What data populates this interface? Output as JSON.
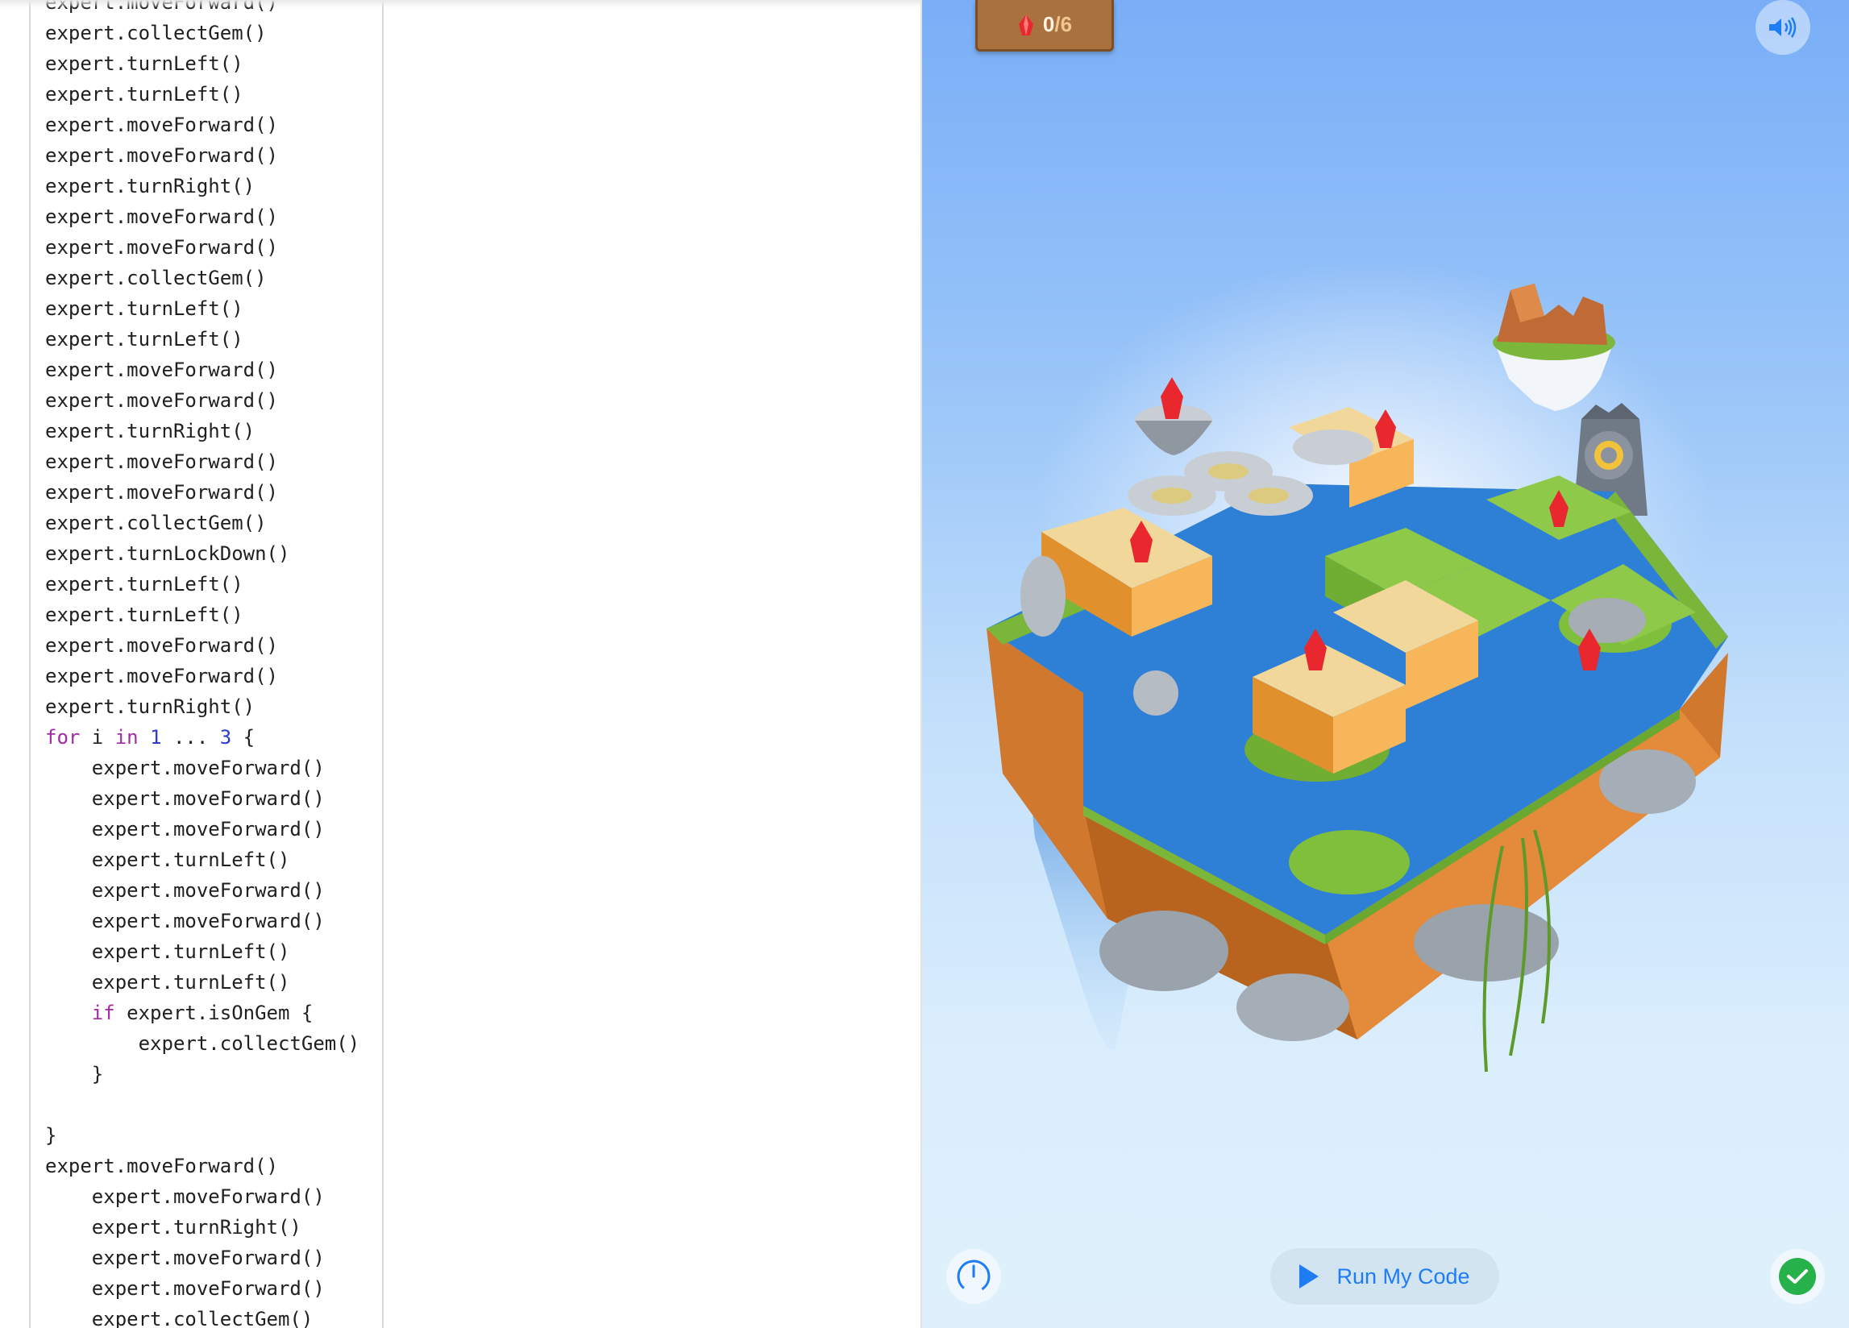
{
  "editor": {
    "code_lines": [
      "expert.moveForward()",
      "expert.collectGem()",
      "expert.turnLeft()",
      "expert.turnLeft()",
      "expert.moveForward()",
      "expert.moveForward()",
      "expert.turnRight()",
      "expert.moveForward()",
      "expert.moveForward()",
      "expert.collectGem()",
      "expert.turnLeft()",
      "expert.turnLeft()",
      "expert.moveForward()",
      "expert.moveForward()",
      "expert.turnRight()",
      "expert.moveForward()",
      "expert.moveForward()",
      "expert.collectGem()",
      "expert.turnLockDown()",
      "expert.turnLeft()",
      "expert.turnLeft()",
      "expert.moveForward()",
      "expert.moveForward()",
      "expert.turnRight()",
      "for i in 1 ... 3 {",
      "    expert.moveForward()",
      "    expert.moveForward()",
      "    expert.moveForward()",
      "    expert.turnLeft()",
      "    expert.moveForward()",
      "    expert.moveForward()",
      "    expert.turnLeft()",
      "    expert.turnLeft()",
      "    if expert.isOnGem {",
      "        expert.collectGem()",
      "    }",
      "",
      "}",
      "expert.moveForward()",
      "    expert.moveForward()",
      "    expert.turnRight()",
      "    expert.moveForward()",
      "    expert.moveForward()",
      "    expert.collectGem()"
    ]
  },
  "scene": {
    "gem_counter": {
      "collected": "0",
      "total": "/6",
      "icon": "gem-icon"
    },
    "sound_icon": "speaker-icon",
    "speed_icon": "speedometer-icon",
    "run_button_label": "Run My Code",
    "run_icon": "play-icon",
    "done_icon": "checkmark-icon",
    "colors": {
      "accent": "#1e7cf5",
      "gem": "#e8282e",
      "success": "#27b14b",
      "sky_top": "#79aef7",
      "sky_bottom": "#dff0fc"
    }
  }
}
